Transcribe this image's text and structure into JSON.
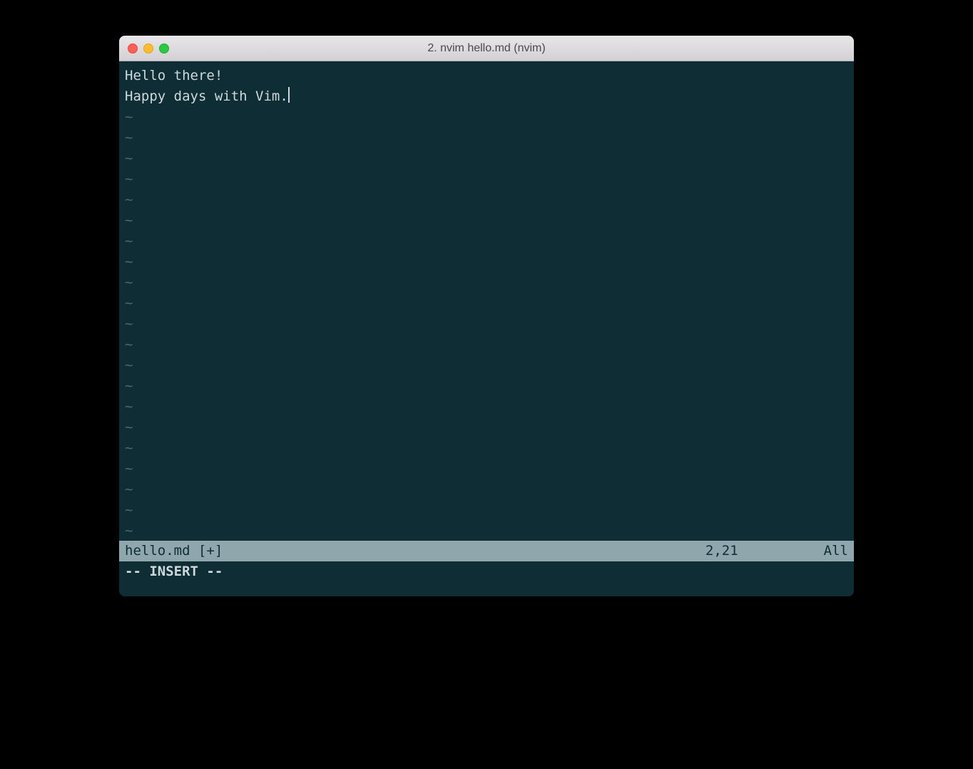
{
  "window": {
    "title": "2. nvim hello.md (nvim)"
  },
  "buffer": {
    "lines": [
      "Hello there!",
      "Happy days with Vim."
    ],
    "cursor_line": 1,
    "tilde": "~",
    "tilde_count": 21
  },
  "statusline": {
    "filename": "hello.md [+]",
    "position": "2,21",
    "scroll": "All"
  },
  "commandline": {
    "mode": "-- INSERT --"
  }
}
